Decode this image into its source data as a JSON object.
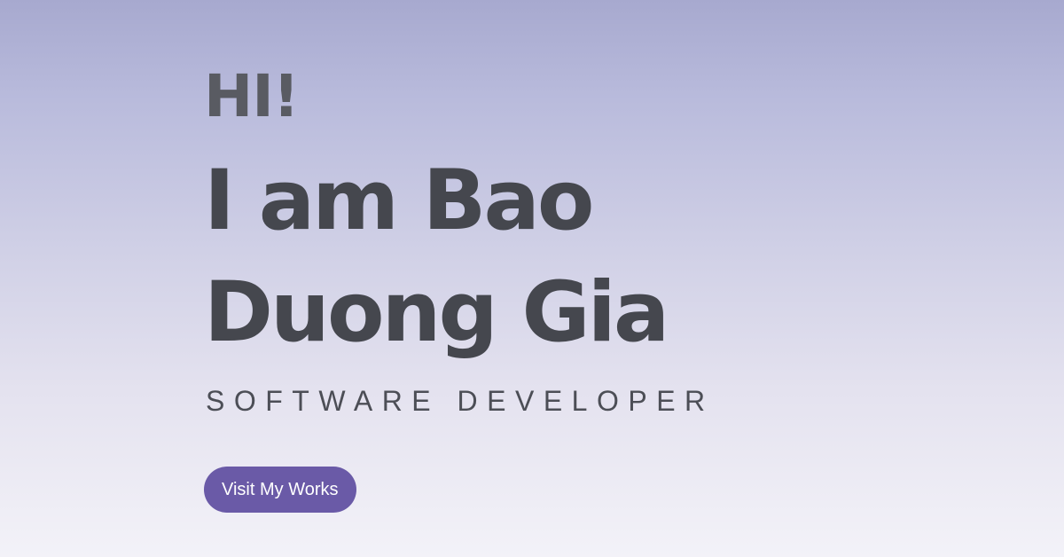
{
  "hero": {
    "greeting": "HI!",
    "name": "I am Bao Duong Gia",
    "role": "SOFTWARE DEVELOPER",
    "cta_label": "Visit My Works"
  },
  "colors": {
    "button_background": "#6a5aa7",
    "heading_text": "#45474e"
  }
}
